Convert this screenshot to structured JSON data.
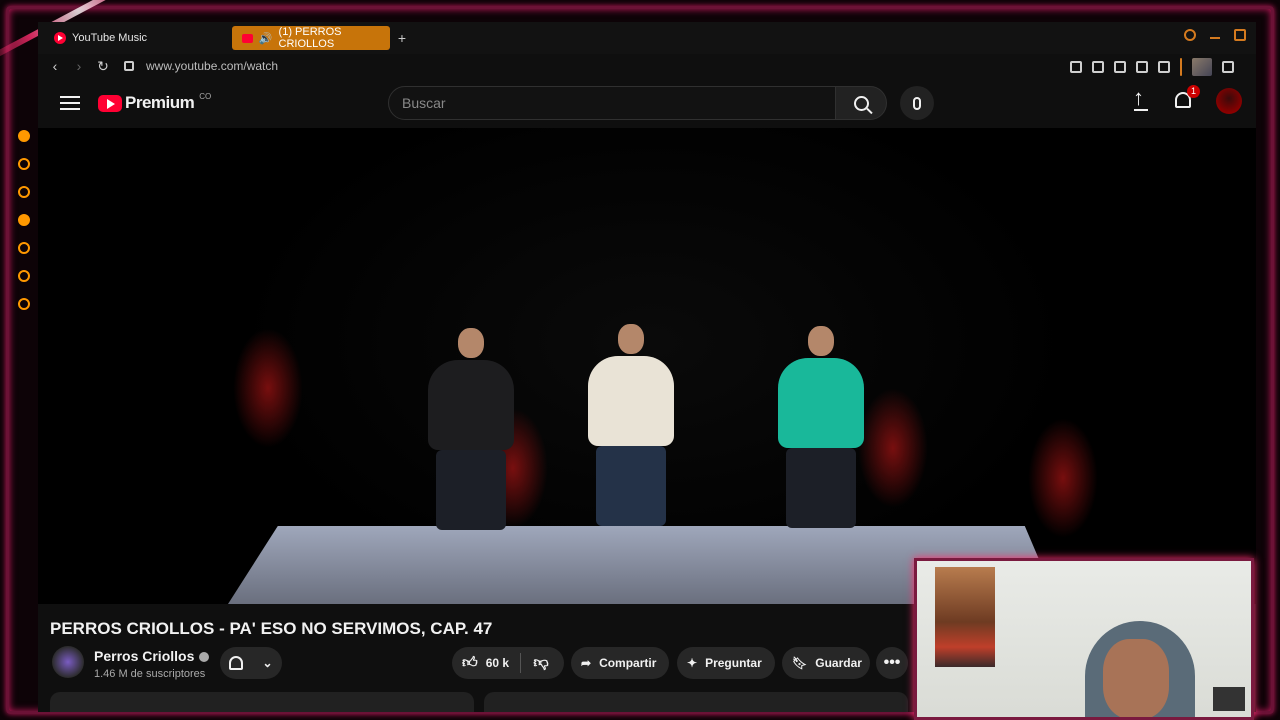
{
  "browser": {
    "tabs": [
      {
        "label": "YouTube Music",
        "active": false
      },
      {
        "label": "(1) PERROS CRIOLLOS",
        "active": true
      }
    ],
    "new_tab_icon": "plus-icon",
    "url": "www.youtube.com/watch"
  },
  "header": {
    "logo_text": "Premium",
    "country_code": "CO",
    "search_placeholder": "Buscar",
    "notification_count": "1"
  },
  "video": {
    "title": "PERROS CRIOLLOS - PA' ESO NO SERVIMOS, CAP. 47",
    "channel_name": "Perros Criollos",
    "subscribers": "1.46 M de suscriptores",
    "likes": "60 k",
    "actions": {
      "share": "Compartir",
      "ask": "Preguntar",
      "save": "Guardar"
    }
  },
  "colors": {
    "accent_frame": "#c2185b",
    "tab_active": "#c7740a",
    "youtube_red": "#ff0033",
    "background": "#0f0f0f"
  }
}
